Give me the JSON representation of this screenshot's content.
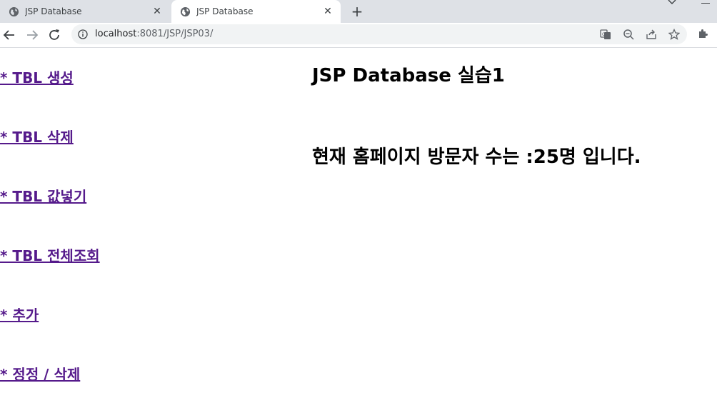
{
  "browser": {
    "tabs": [
      {
        "title": "JSP Database",
        "active": false
      },
      {
        "title": "JSP Database",
        "active": true
      }
    ],
    "url_host": "localhost",
    "url_rest": ":8081/JSP/JSP03/"
  },
  "menu": {
    "items": [
      {
        "label": "* TBL 생성"
      },
      {
        "label": "* TBL 삭제"
      },
      {
        "label": "* TBL 값넣기"
      },
      {
        "label": "* TBL 전체조회"
      },
      {
        "label": "* 추가"
      },
      {
        "label": "* 정정 / 삭제"
      }
    ]
  },
  "main": {
    "heading": "JSP Database 실습1",
    "visitor_text": "현재 홈페이지 방문자 수는 :25명 입니다."
  },
  "colors": {
    "link_visited": "#551a8b",
    "tabbar": "#dee1e6",
    "omnibox": "#f1f3f4"
  }
}
